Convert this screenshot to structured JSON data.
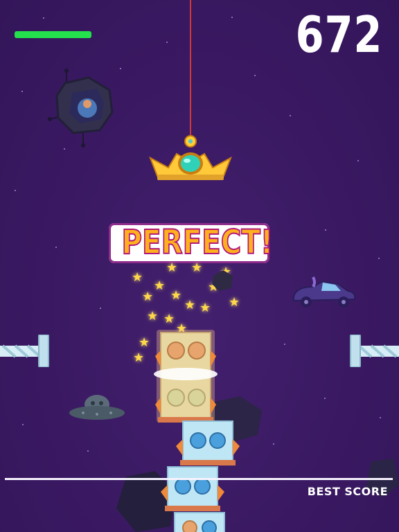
{
  "hud": {
    "score": "672",
    "health_fraction": 1.0,
    "health_color": "#24e04d"
  },
  "feedback": {
    "label": "PERFECT!",
    "text_color": "#ffb01e",
    "outline_color": "#b0177a"
  },
  "best_score": {
    "label": "BEST SCORE"
  },
  "icons": {
    "crown": "crown-hook-icon",
    "asteroid": "asteroid-pod-icon",
    "ufo": "ufo-icon",
    "car": "space-car-icon",
    "star": "star-icon"
  },
  "colors": {
    "background": "#3b1a63",
    "rope": "#d2383a",
    "block_glass": "#bfe6f5"
  }
}
